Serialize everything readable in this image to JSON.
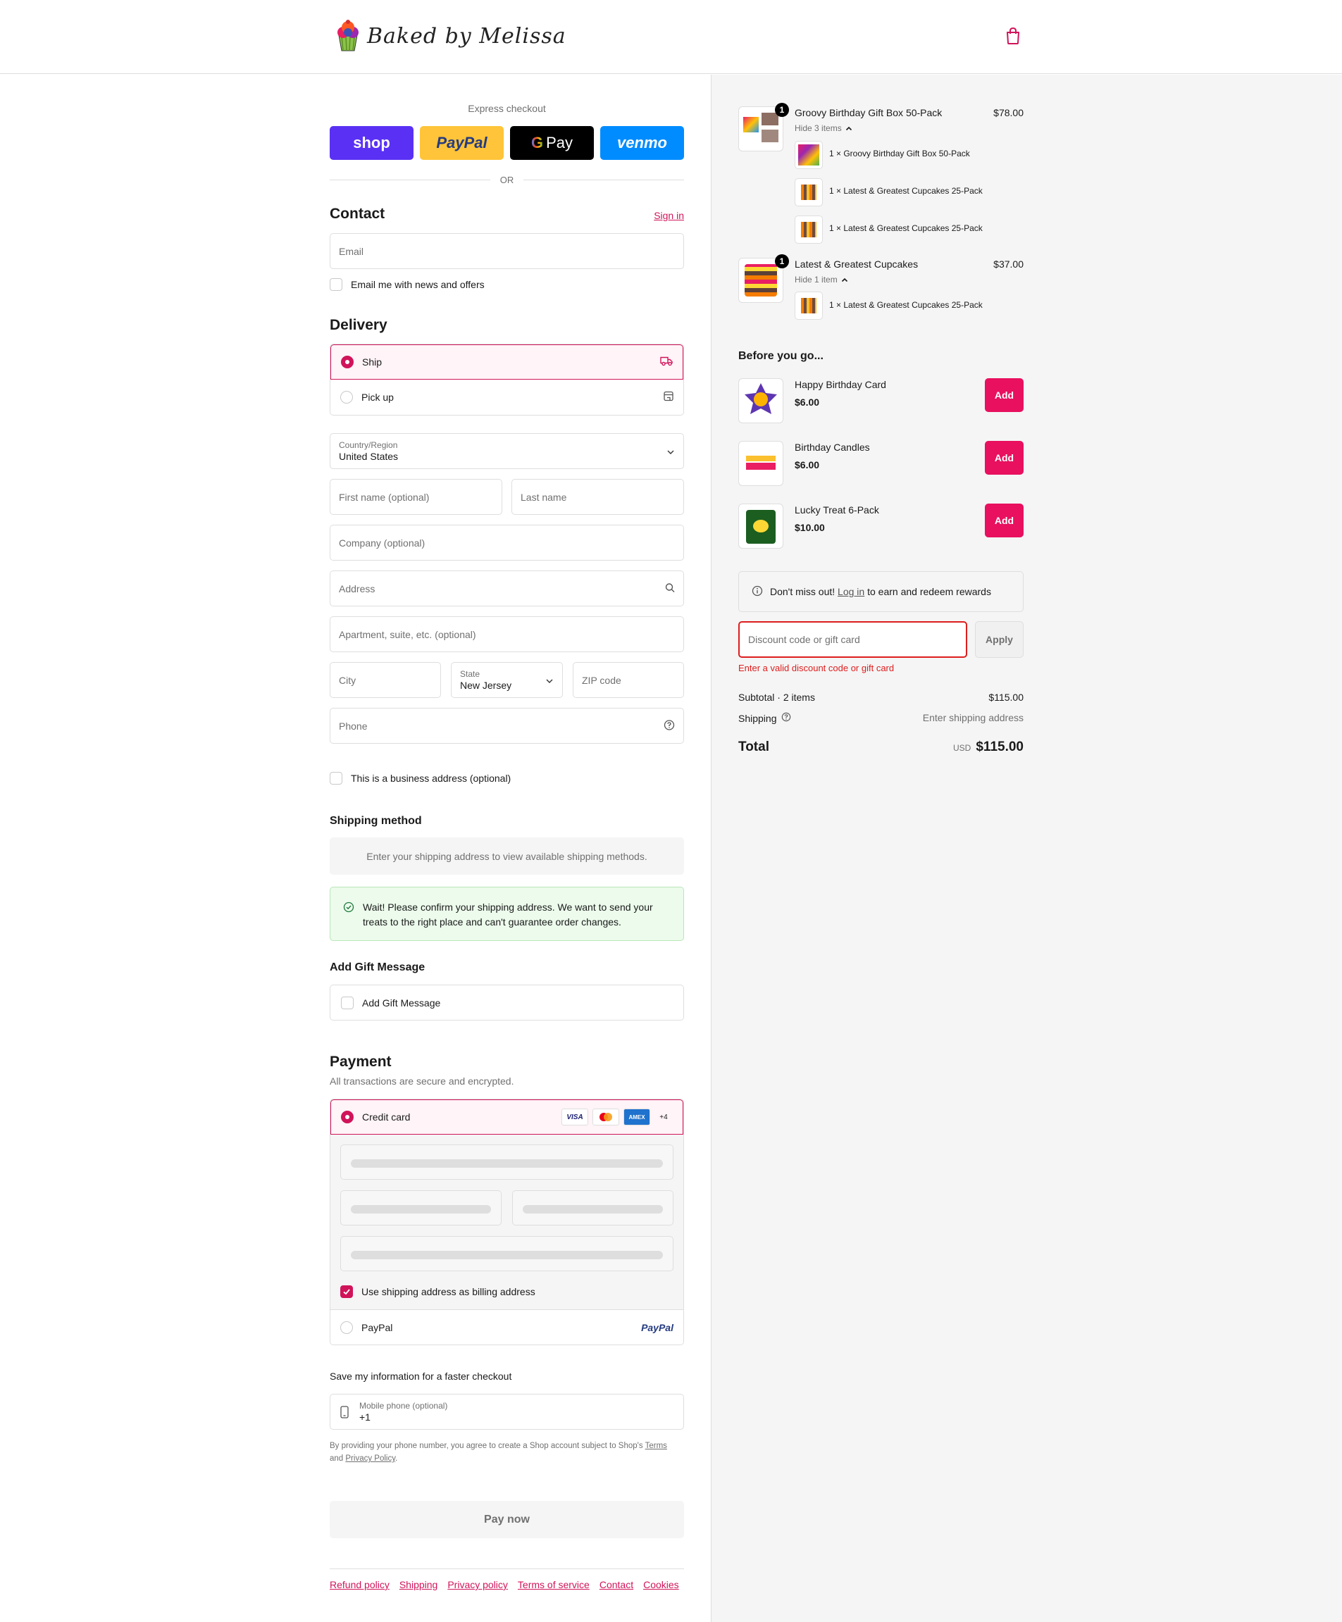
{
  "header": {
    "brand": "Baked by Melissa",
    "cart_icon": "shopping-bag-icon"
  },
  "express": {
    "label": "Express checkout",
    "shop": "shop",
    "paypal": "PayPal",
    "gpay": "Pay",
    "venmo": "venmo",
    "or": "OR"
  },
  "contact": {
    "title": "Contact",
    "sign_in": "Sign in",
    "email_placeholder": "Email",
    "news_label": "Email me with news and offers"
  },
  "delivery": {
    "title": "Delivery",
    "ship": "Ship",
    "pickup": "Pick up",
    "country_label": "Country/Region",
    "country_value": "United States",
    "first_name": "First name (optional)",
    "last_name": "Last name",
    "company": "Company (optional)",
    "address": "Address",
    "apartment": "Apartment, suite, etc. (optional)",
    "city": "City",
    "state_label": "State",
    "state_value": "New Jersey",
    "zip": "ZIP code",
    "phone": "Phone",
    "business_label": "This is a business address (optional)"
  },
  "shipping": {
    "title": "Shipping method",
    "notice": "Enter your shipping address to view available shipping methods.",
    "confirm_line1": "Wait! Please confirm your shipping address. We want to send your",
    "confirm_line2": "treats to the right place and can't guarantee order changes."
  },
  "gift": {
    "title": "Add Gift Message",
    "checkbox_label": "Add Gift Message"
  },
  "payment": {
    "title": "Payment",
    "subtitle": "All transactions are secure and encrypted.",
    "credit_card": "Credit card",
    "card_visa": "VISA",
    "card_amex": "AMEX",
    "card_more": "+4",
    "billing_same": "Use shipping address as billing address",
    "paypal": "PayPal",
    "paypal_logo": "PayPal"
  },
  "save_info": {
    "title": "Save my information for a faster checkout",
    "mobile_label": "Mobile phone (optional)",
    "mobile_value": "+1",
    "disclaimer_prefix": "By providing your phone number, you agree to create a Shop account subject to Shop's",
    "terms": "Terms",
    "and": "and",
    "privacy": "Privacy Policy",
    "period": "."
  },
  "pay_now": "Pay now",
  "footer": {
    "links": [
      "Refund policy",
      "Shipping",
      "Privacy policy",
      "Terms of service",
      "Contact",
      "Cookies"
    ]
  },
  "summary": {
    "items": [
      {
        "qty": "1",
        "title": "Groovy Birthday Gift Box 50-Pack",
        "price": "$78.00",
        "hide": "Hide 3 items",
        "sub_items": [
          "1 × Groovy Birthday Gift Box 50-Pack",
          "1 × Latest & Greatest Cupcakes 25-Pack",
          "1 × Latest & Greatest Cupcakes 25-Pack"
        ]
      },
      {
        "qty": "1",
        "title": "Latest & Greatest Cupcakes",
        "price": "$37.00",
        "hide": "Hide 1 item",
        "sub_items": [
          "1 × Latest & Greatest Cupcakes 25-Pack"
        ]
      }
    ],
    "upsell_title": "Before you go...",
    "upsells": [
      {
        "name": "Happy Birthday Card",
        "price": "$6.00",
        "button": "Add"
      },
      {
        "name": "Birthday Candles",
        "price": "$6.00",
        "button": "Add"
      },
      {
        "name": "Lucky Treat 6-Pack",
        "price": "$10.00",
        "button": "Add"
      }
    ],
    "rewards_prefix": "Don't miss out!",
    "rewards_link": "Log in",
    "rewards_suffix": "to earn and redeem rewards",
    "discount_placeholder": "Discount code or gift card",
    "apply": "Apply",
    "discount_error": "Enter a valid discount code or gift card",
    "subtotal_label": "Subtotal · 2 items",
    "subtotal_value": "$115.00",
    "shipping_label": "Shipping",
    "shipping_value": "Enter shipping address",
    "total_label": "Total",
    "currency": "USD",
    "total_value": "$115.00"
  },
  "colors": {
    "accent": "#d0145a",
    "add_button": "#e8105f",
    "summary_bg": "#f5f5f5",
    "success_bg": "#ecfbec"
  }
}
